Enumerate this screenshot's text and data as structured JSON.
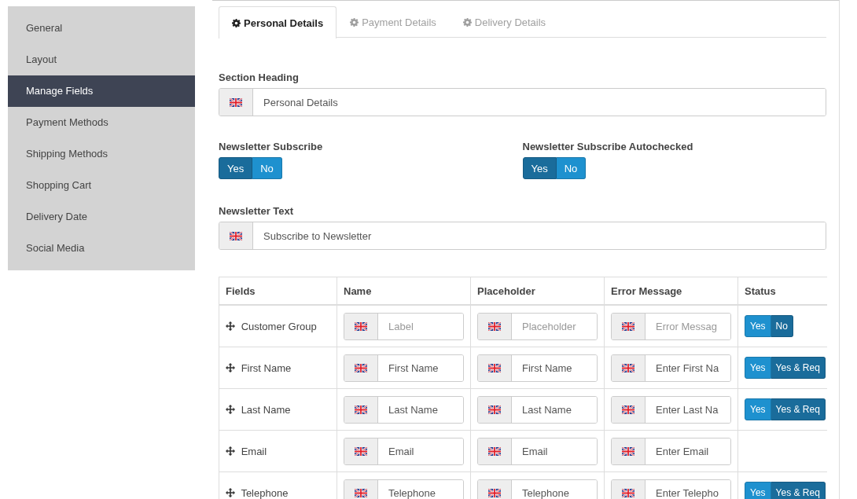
{
  "sidebar": {
    "items": [
      {
        "label": "General",
        "selected": false
      },
      {
        "label": "Layout",
        "selected": false
      },
      {
        "label": "Manage Fields",
        "selected": true
      },
      {
        "label": "Payment Methods",
        "selected": false
      },
      {
        "label": "Shipping Methods",
        "selected": false
      },
      {
        "label": "Shopping Cart",
        "selected": false
      },
      {
        "label": "Delivery Date",
        "selected": false
      },
      {
        "label": "Social Media",
        "selected": false
      }
    ]
  },
  "tabs": [
    {
      "label": "Personal Details",
      "selected": true
    },
    {
      "label": "Payment Details",
      "selected": false
    },
    {
      "label": "Delivery Details",
      "selected": false
    }
  ],
  "section_heading": {
    "label": "Section Heading",
    "value": "Personal Details"
  },
  "toggles": [
    {
      "label": "Newsletter Subscribe",
      "options": [
        {
          "label": "Yes",
          "selected": true
        },
        {
          "label": "No",
          "selected": false
        }
      ]
    },
    {
      "label": "Newsletter Subscribe Autochecked",
      "options": [
        {
          "label": "Yes",
          "selected": true
        },
        {
          "label": "No",
          "selected": false
        }
      ]
    }
  ],
  "newsletter_text": {
    "label": "Newsletter Text",
    "value": "Subscribe to Newsletter"
  },
  "table": {
    "columns": [
      "Fields",
      "Name",
      "Placeholder",
      "Error Message",
      "Status"
    ],
    "rows": [
      {
        "field": "Customer Group",
        "name": {
          "placeholder": "Label"
        },
        "placeholder": {
          "placeholder": "Placeholder"
        },
        "error": {
          "placeholder": "Error Messag"
        },
        "status": [
          {
            "label": "Yes",
            "selected": false
          },
          {
            "label": "No",
            "selected": true
          }
        ]
      },
      {
        "field": "First Name",
        "name": {
          "value": "First Name"
        },
        "placeholder": {
          "value": "First Name"
        },
        "error": {
          "value": "Enter First Na"
        },
        "status": [
          {
            "label": "Yes",
            "selected": false
          },
          {
            "label": "Yes & Req",
            "selected": true
          }
        ]
      },
      {
        "field": "Last Name",
        "name": {
          "value": "Last Name"
        },
        "placeholder": {
          "value": "Last Name"
        },
        "error": {
          "value": "Enter Last Na"
        },
        "status": [
          {
            "label": "Yes",
            "selected": false
          },
          {
            "label": "Yes & Req",
            "selected": true
          }
        ]
      },
      {
        "field": "Email",
        "name": {
          "value": "Email"
        },
        "placeholder": {
          "value": "Email"
        },
        "error": {
          "value": "Enter Email"
        }
      },
      {
        "field": "Telephone",
        "name": {
          "value": "Telephone"
        },
        "placeholder": {
          "value": "Telephone"
        },
        "error": {
          "value": "Enter Telepho"
        },
        "status": [
          {
            "label": "Yes",
            "selected": false
          },
          {
            "label": "Yes & Req",
            "selected": true
          }
        ]
      }
    ]
  }
}
